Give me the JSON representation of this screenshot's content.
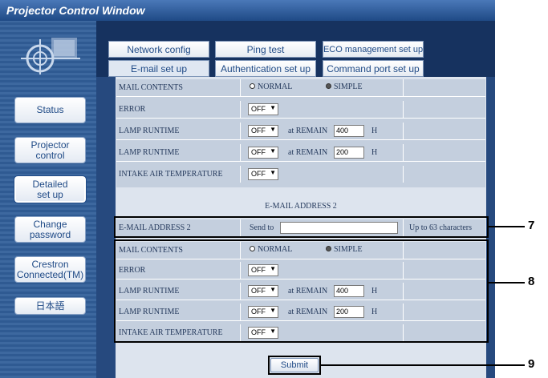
{
  "window": {
    "title": "Projector Control Window"
  },
  "sidebar": {
    "items": [
      {
        "label": "Status"
      },
      {
        "label": "Projector\ncontrol"
      },
      {
        "label": "Detailed\nset up"
      },
      {
        "label": "Change\npassword"
      },
      {
        "label": "Crestron\nConnected(TM)"
      },
      {
        "label": "日本語"
      }
    ]
  },
  "tabs": {
    "row1": [
      "Network config",
      "Ping test",
      "ECO management set up"
    ],
    "row2": [
      "E-mail set up",
      "Authentication set up",
      "Command port set up"
    ],
    "active": "E-mail set up"
  },
  "address1_settings": {
    "mail_contents": {
      "label": "MAIL CONTENTS",
      "options": [
        "NORMAL",
        "SIMPLE"
      ],
      "selected": "SIMPLE"
    },
    "error": {
      "label": "ERROR",
      "value": "OFF"
    },
    "lamp1": {
      "label": "LAMP RUNTIME",
      "value": "OFF",
      "remain_label": "at REMAIN",
      "remain": "400",
      "unit": "H"
    },
    "lamp2": {
      "label": "LAMP RUNTIME",
      "value": "OFF",
      "remain_label": "at REMAIN",
      "remain": "200",
      "unit": "H"
    },
    "intake": {
      "label": "INTAKE AIR TEMPERATURE",
      "value": "OFF"
    }
  },
  "address2": {
    "section_title": "E-MAIL ADDRESS 2",
    "label": "E-MAIL ADDRESS 2",
    "send_to": "Send to",
    "value": "",
    "limit": "Up to 63 characters"
  },
  "address2_settings": {
    "mail_contents": {
      "label": "MAIL CONTENTS",
      "options": [
        "NORMAL",
        "SIMPLE"
      ],
      "selected": "SIMPLE"
    },
    "error": {
      "label": "ERROR",
      "value": "OFF"
    },
    "lamp1": {
      "label": "LAMP RUNTIME",
      "value": "OFF",
      "remain_label": "at REMAIN",
      "remain": "400",
      "unit": "H"
    },
    "lamp2": {
      "label": "LAMP RUNTIME",
      "value": "OFF",
      "remain_label": "at REMAIN",
      "remain": "200",
      "unit": "H"
    },
    "intake": {
      "label": "INTAKE AIR TEMPERATURE",
      "value": "OFF"
    }
  },
  "submit": {
    "label": "Submit"
  },
  "callouts": {
    "email": "7",
    "settings": "8",
    "submit": "9"
  },
  "colors": {
    "window_bg": "#2a4f86",
    "titlebar": "#1f4a86",
    "content_bg": "#dde4ee",
    "cell_bg": "#c4cfde"
  }
}
